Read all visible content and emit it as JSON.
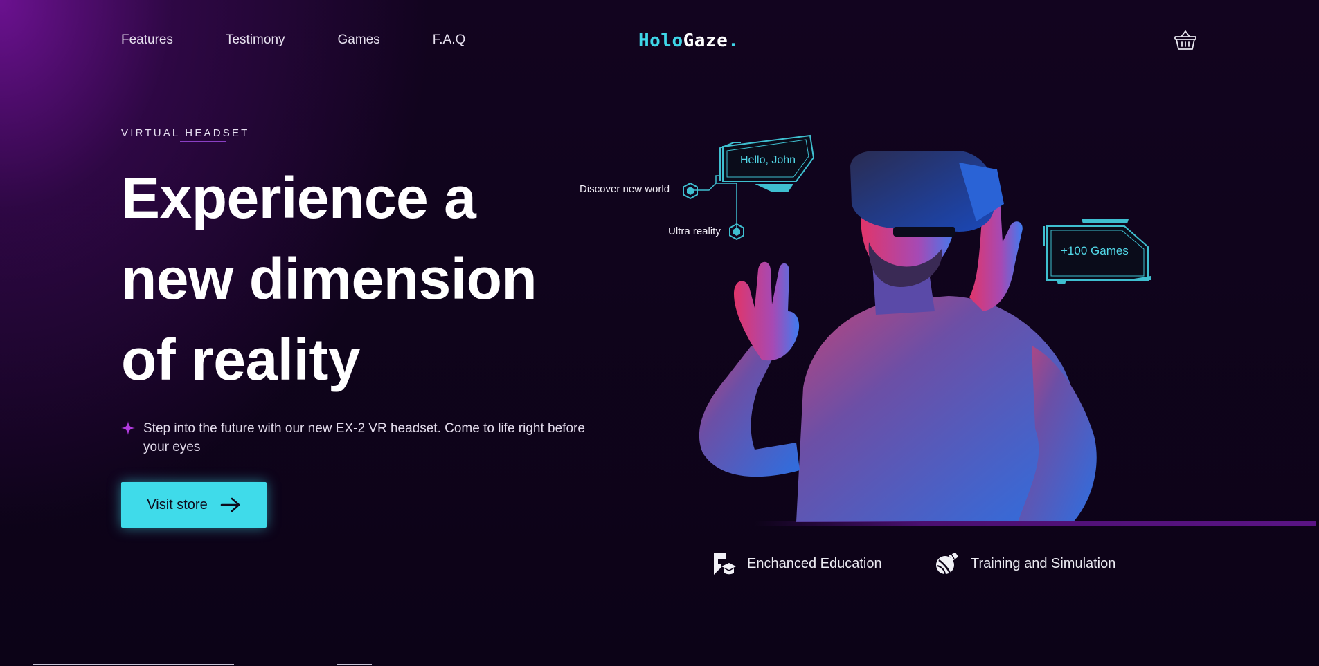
{
  "nav": {
    "links": [
      "Features",
      "Testimony",
      "Games",
      "F.A.Q"
    ],
    "cart_icon": "basket-icon"
  },
  "logo": {
    "part1": "Holo",
    "part2": "Gaze",
    "dot": "."
  },
  "hero": {
    "eyebrow": "VIRTUAL HEADSET",
    "headline": [
      "Experience a",
      "new dimension",
      "of reality"
    ],
    "description": "Step into the future with our new EX-2 VR headset. Come to life right before your eyes",
    "sparkle_icon": "sparkle-icon",
    "cta_label": "Visit store",
    "cta_icon": "arrow-right-icon"
  },
  "hud": {
    "greeting": "Hello, John",
    "discover": "Discover new world",
    "ultra": "Ultra reality",
    "games": "+100 Games"
  },
  "features": [
    {
      "label": "Enchanced Education",
      "icon": "education-icon"
    },
    {
      "label": "Training and Simulation",
      "icon": "training-icon"
    }
  ],
  "colors": {
    "accent": "#3fdbea",
    "background": "#0e0419",
    "purple": "#7a14a8",
    "sparkle": "#b23be0"
  }
}
